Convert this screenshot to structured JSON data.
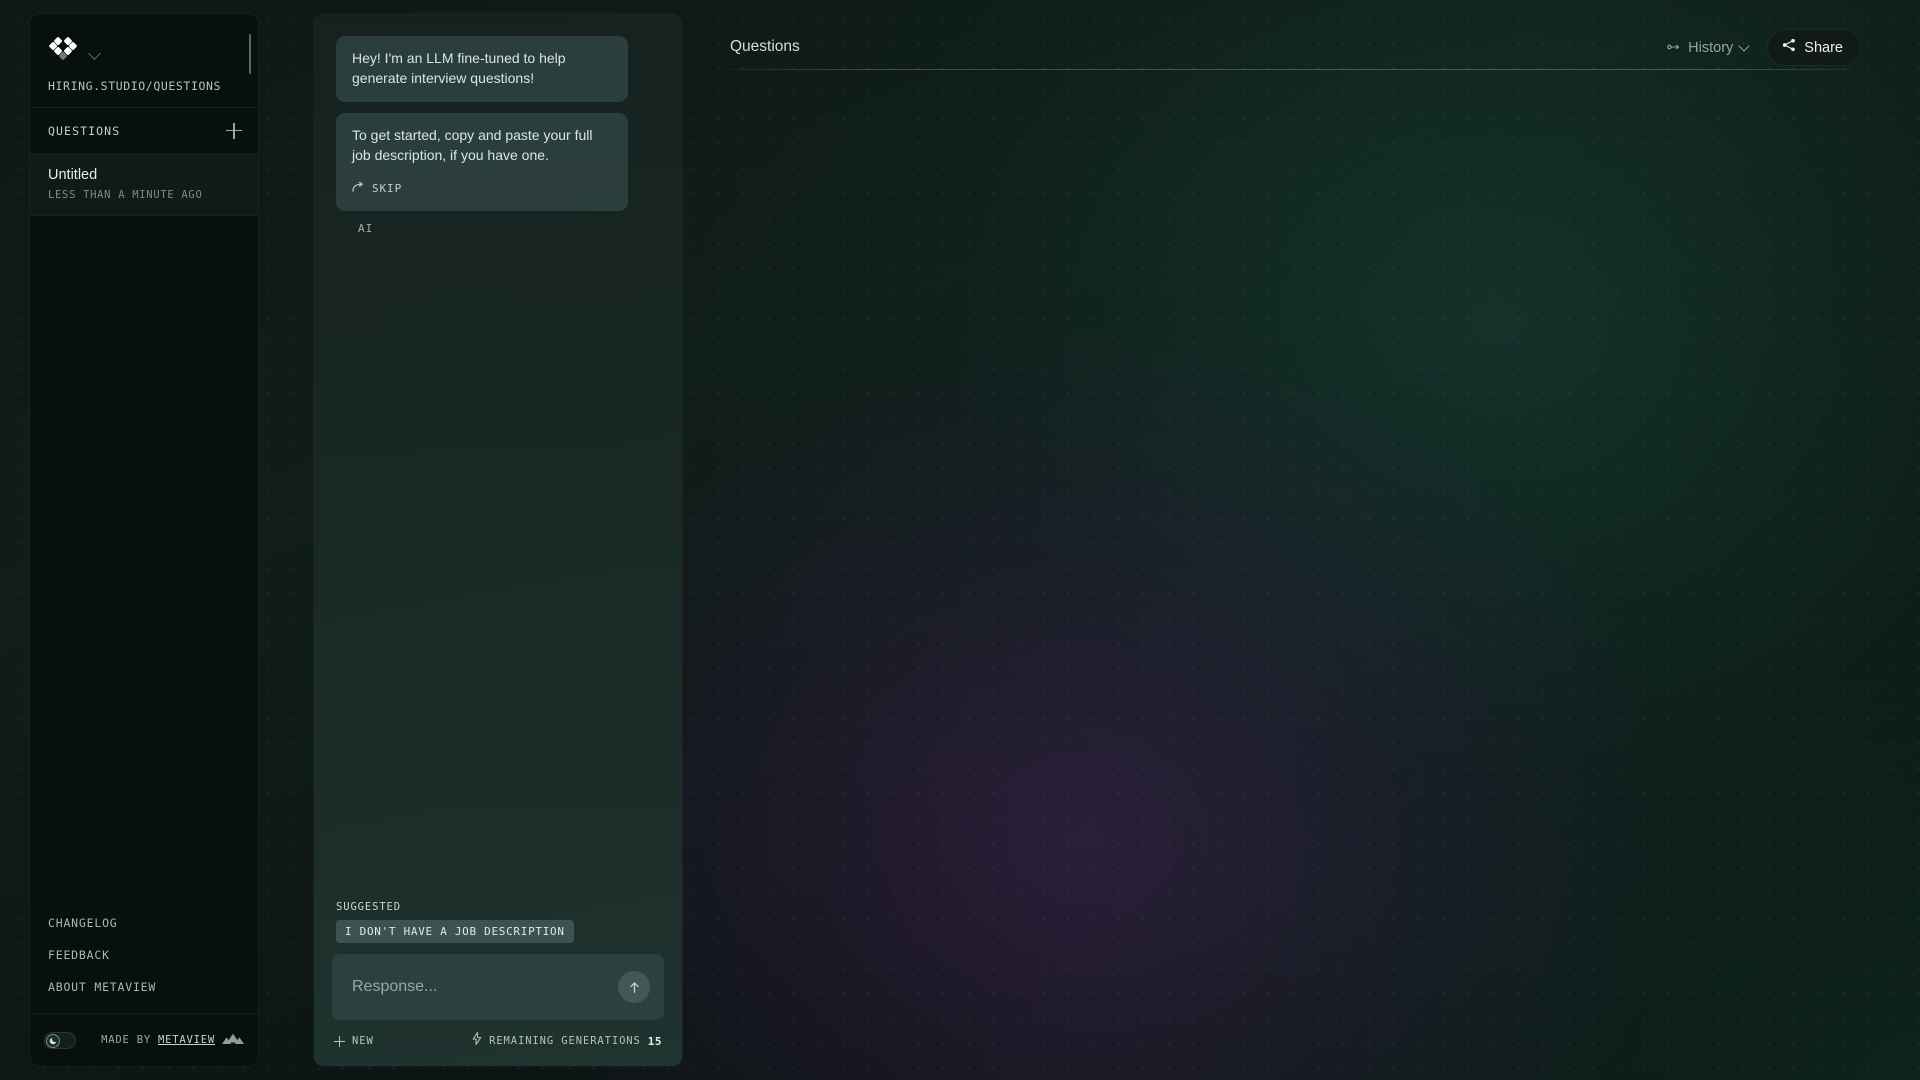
{
  "sidebar": {
    "logo_icon": "metaview-diamond-logo",
    "workspace_chevron_icon": "chevron-down-icon",
    "url": "HIRING.STUDIO/QUESTIONS",
    "section": {
      "title": "QUESTIONS",
      "add_icon": "plus-icon"
    },
    "items": [
      {
        "title": "Untitled",
        "subtitle": "LESS THAN A MINUTE AGO",
        "selected": true
      }
    ],
    "links": [
      {
        "label": "CHANGELOG"
      },
      {
        "label": "FEEDBACK"
      },
      {
        "label": "ABOUT METAVIEW"
      }
    ],
    "footer": {
      "theme_toggle_icon": "moon-icon",
      "theme_toggle_state": "dark",
      "made_by_prefix": "MADE BY",
      "made_by_brand": "METAVIEW",
      "brand_mark_icon": "metaview-mountains-icon"
    }
  },
  "chat": {
    "messages": [
      {
        "text": "Hey! I'm an LLM fine-tuned to help generate interview questions!"
      },
      {
        "text": "To get started, copy and paste your full job description, if you have one.",
        "action_label": "SKIP",
        "action_icon": "skip-arrow-icon"
      }
    ],
    "sender_tag": "AI",
    "suggested": {
      "label": "SUGGESTED",
      "chips": [
        "I DON'T HAVE A JOB DESCRIPTION"
      ]
    },
    "composer": {
      "placeholder": "Response...",
      "value": "",
      "send_icon": "arrow-up-icon"
    },
    "footer": {
      "new_label": "NEW",
      "new_icon": "plus-icon",
      "generations_icon": "lightning-icon",
      "generations_label": "REMAINING GENERATIONS",
      "generations_count": "15"
    }
  },
  "main": {
    "title": "Questions",
    "history": {
      "label": "History",
      "icon": "history-icon",
      "chevron_icon": "chevron-down-icon"
    },
    "share": {
      "label": "Share",
      "icon": "share-nodes-icon"
    }
  },
  "theme": {
    "accent_green": "#1a2a25",
    "panel_bg": "#07100e",
    "bubble_bg": "#3c5656",
    "chip_bg": "#5c7676",
    "text_primary": "#e6edeb",
    "text_muted": "#9aa8a5",
    "glow_purple": "#702d8c",
    "glow_green": "#18463a"
  }
}
